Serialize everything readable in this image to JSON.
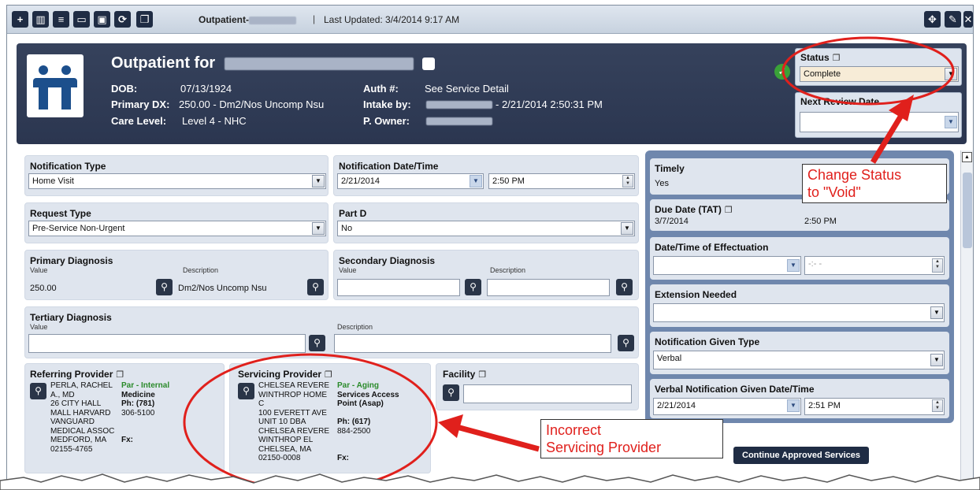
{
  "toolbar": {
    "title": "Outpatient-",
    "separator": "|",
    "updated": "Last Updated: 3/4/2014 9:17 AM",
    "buttons": [
      {
        "name": "add-icon",
        "glyph": "+"
      },
      {
        "name": "book-icon",
        "glyph": "▥"
      },
      {
        "name": "document-icon",
        "glyph": "≡"
      },
      {
        "name": "save-icon",
        "glyph": "▭"
      },
      {
        "name": "save-close-icon",
        "glyph": "▣"
      },
      {
        "name": "refresh-icon",
        "glyph": "⟳"
      },
      {
        "name": "copy-icon",
        "glyph": "❐"
      }
    ],
    "right_buttons": [
      {
        "name": "move-icon",
        "glyph": "✥"
      },
      {
        "name": "edit-icon",
        "glyph": "✎"
      },
      {
        "name": "close-icon",
        "glyph": "✕"
      }
    ]
  },
  "header": {
    "title": "Outpatient for",
    "dob_label": "DOB:",
    "dob": "07/13/1924",
    "primary_dx_label": "Primary DX:",
    "primary_dx": "250.00 - Dm2/Nos Uncomp Nsu",
    "care_level_label": "Care Level:",
    "care_level": "Level 4 - NHC",
    "auth_label": "Auth #:",
    "auth": "See Service Detail",
    "intake_label": "Intake by:",
    "intake": "- 2/21/2014 2:50:31 PM",
    "owner_label": "P. Owner:",
    "status_label": "Status",
    "status_value": "Complete",
    "next_review_label": "Next Review Date",
    "next_review_value": ""
  },
  "form": {
    "notification_type_label": "Notification Type",
    "notification_type": "Home Visit",
    "notification_dt_label": "Notification Date/Time",
    "notification_date": "2/21/2014",
    "notification_time": "2:50 PM",
    "request_type_label": "Request Type",
    "request_type": "Pre-Service Non-Urgent",
    "part_d_label": "Part D",
    "part_d": "No",
    "primary_dx_label": "Primary Diagnosis",
    "value_label": "Value",
    "description_label": "Description",
    "primary_dx_value": "250.00",
    "primary_dx_desc": "Dm2/Nos Uncomp Nsu",
    "secondary_dx_label": "Secondary Diagnosis",
    "tertiary_dx_label": "Tertiary Diagnosis",
    "referring_label": "Referring Provider",
    "referring_name": [
      "PERLA, RACHEL",
      "A., MD",
      "26 CITY HALL",
      "MALL HARVARD",
      "VANGUARD",
      "MEDICAL ASSOC",
      "MEDFORD, MA",
      "02155-4765"
    ],
    "referring_par": "Par - Internal",
    "referring_spec": "Medicine",
    "referring_ph": "Ph: (781)",
    "referring_ph2": "306-5100",
    "referring_fx": "Fx:",
    "servicing_label": "Servicing Provider",
    "servicing_name": [
      "CHELSEA REVERE",
      "WINTHROP HOME",
      "C",
      "100 EVERETT AVE",
      "UNIT 10 DBA",
      "CHELSEA REVERE",
      "WINTHROP EL",
      "CHELSEA, MA",
      "02150-0008"
    ],
    "servicing_par": "Par - Aging",
    "servicing_spec1": "Services Access",
    "servicing_spec2": "Point (Asap)",
    "servicing_ph": "Ph: (617)",
    "servicing_ph2": "884-2500",
    "servicing_fx": "Fx:",
    "facility_label": "Facility",
    "facility_value": ""
  },
  "right": {
    "timely_label": "Timely",
    "timely": "Yes",
    "due_label": "Due Date (TAT)",
    "due_date": "3/7/2014",
    "due_time": "2:50 PM",
    "effectuation_label": "Date/Time of Effectuation",
    "effectuation_time": "-:- -",
    "extension_label": "Extension Needed",
    "extension_value": "",
    "notif_given_label": "Notification Given Type",
    "notif_given": "Verbal",
    "verbal_label": "Verbal Notification Given Date/Time",
    "verbal_date": "2/21/2014",
    "verbal_time": "2:51 PM"
  },
  "continue_button": "Continue Approved Services",
  "annotations": {
    "status_note": [
      "Change Status",
      "to \"Void\""
    ],
    "provider_note": [
      "Incorrect",
      "Servicing Provider"
    ],
    "color": "#e0201c"
  }
}
